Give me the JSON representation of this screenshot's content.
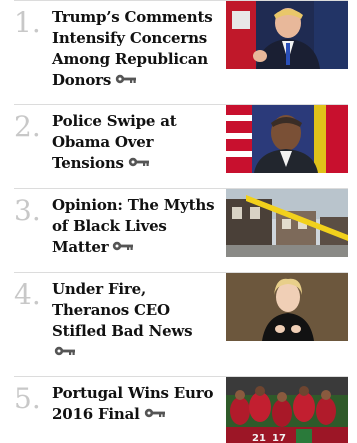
{
  "articles": [
    {
      "number": "1.",
      "title": "Trump’s Comments Intensify Concerns Among Republican Donors",
      "icon": "key-icon",
      "image": "trump-photo"
    },
    {
      "number": "2.",
      "title": "Police Swipe at Obama Over Tensions",
      "icon": "key-icon",
      "image": "obama-photo"
    },
    {
      "number": "3.",
      "title": "Opinion: The Myths of Black Lives Matter",
      "icon": "key-icon",
      "image": "police-tape-photo"
    },
    {
      "number": "4.",
      "title": "Under Fire, Theranos CEO Stifled Bad News",
      "icon": "key-icon",
      "image": "theranos-ceo-photo"
    },
    {
      "number": "5.",
      "title": "Portugal Wins Euro 2016 Final",
      "icon": "key-icon",
      "image": "portugal-team-photo"
    }
  ],
  "colors": {
    "number": "#c8c8c8",
    "title": "#111111",
    "divider": "#dcdcdc",
    "icon": "#555555"
  }
}
